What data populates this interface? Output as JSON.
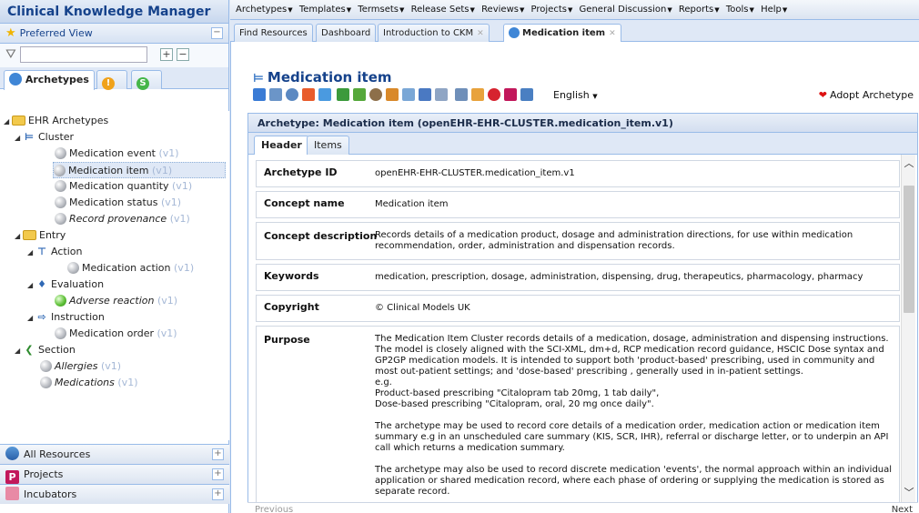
{
  "app": {
    "title": "Clinical Knowledge Manager"
  },
  "left": {
    "preferred_view": "Preferred View",
    "filter_placeholder": "",
    "tabs": [
      {
        "label": "Archetypes"
      },
      {
        "label": ""
      },
      {
        "label": ""
      }
    ],
    "tree": {
      "root": "EHR Archetypes",
      "cluster": "Cluster",
      "cluster_items": [
        {
          "label": "Medication event",
          "ver": "(v1)"
        },
        {
          "label": "Medication item",
          "ver": "(v1)"
        },
        {
          "label": "Medication quantity",
          "ver": "(v1)"
        },
        {
          "label": "Medication status",
          "ver": "(v1)"
        },
        {
          "label": "Record provenance",
          "ver": "(v1)"
        }
      ],
      "entry": "Entry",
      "action": "Action",
      "action_item": {
        "label": "Medication action",
        "ver": "(v1)"
      },
      "evaluation": "Evaluation",
      "evaluation_item": {
        "label": "Adverse reaction",
        "ver": "(v1)"
      },
      "instruction": "Instruction",
      "instruction_item": {
        "label": "Medication order",
        "ver": "(v1)"
      },
      "section": "Section",
      "section_items": [
        {
          "label": "Allergies",
          "ver": "(v1)"
        },
        {
          "label": "Medications",
          "ver": "(v1)"
        }
      ]
    },
    "bottom": [
      {
        "label": "All Resources"
      },
      {
        "label": "Projects"
      },
      {
        "label": "Incubators"
      }
    ]
  },
  "menubar": [
    "Archetypes",
    "Templates",
    "Termsets",
    "Release Sets",
    "Reviews",
    "Projects",
    "General Discussion",
    "Reports",
    "Tools",
    "Help"
  ],
  "doc_tabs": [
    "Find Resources",
    "Dashboard",
    "Introduction to CKM",
    "Medication item"
  ],
  "resource": {
    "title": "Medication item",
    "language": "English",
    "adopt": "Adopt Archetype",
    "header_bar": "Archetype: Medication item (openEHR-EHR-CLUSTER.medication_item.v1)",
    "sub_tabs": [
      "Header",
      "Items"
    ],
    "rows": [
      {
        "label": "Archetype ID",
        "value": "openEHR-EHR-CLUSTER.medication_item.v1"
      },
      {
        "label": "Concept name",
        "value": "Medication item"
      },
      {
        "label": "Concept description",
        "value": "Records details of a medication product, dosage and administration directions, for use within medication recommendation, order, administration and dispensation records."
      },
      {
        "label": "Keywords",
        "value": "medication, prescription, dosage, administration, dispensing, drug, therapeutics, pharmacology, pharmacy"
      },
      {
        "label": "Copyright",
        "value": "© Clinical Models UK"
      },
      {
        "label": "Purpose",
        "p1": "The Medication Item Cluster records details of a medication, dosage, administration and dispensing instructions. The model is closely aligned with the SCI-XML, dm+d, RCP medication record guidance, HSCIC Dose syntax and GP2GP medication models. It is intended to support both 'product-based' prescribing, used in community and most out-patient settings; and 'dose-based' prescribing , generally used in in-patient settings.",
        "p2": "e.g.",
        "p3": "Product-based prescribing \"Citalopram tab 20mg, 1 tab daily\",",
        "p4": "Dose-based prescribing \"Citalopram, oral, 20 mg once daily\".",
        "p5": "The archetype may be used to record core details of a medication order, medication action or medication item summary e.g in an unscheduled care summary (KIS, SCR, IHR), referral or discharge letter, or to underpin an API call which returns a medication summary.",
        "p6": "The archetype may also be used to record discrete medication 'events', the normal approach within an individual application or shared medication record, where each phase of ordering or supplying the medication is stored as separate record."
      }
    ],
    "footer": {
      "prev": "Previous",
      "next": "Next"
    }
  }
}
